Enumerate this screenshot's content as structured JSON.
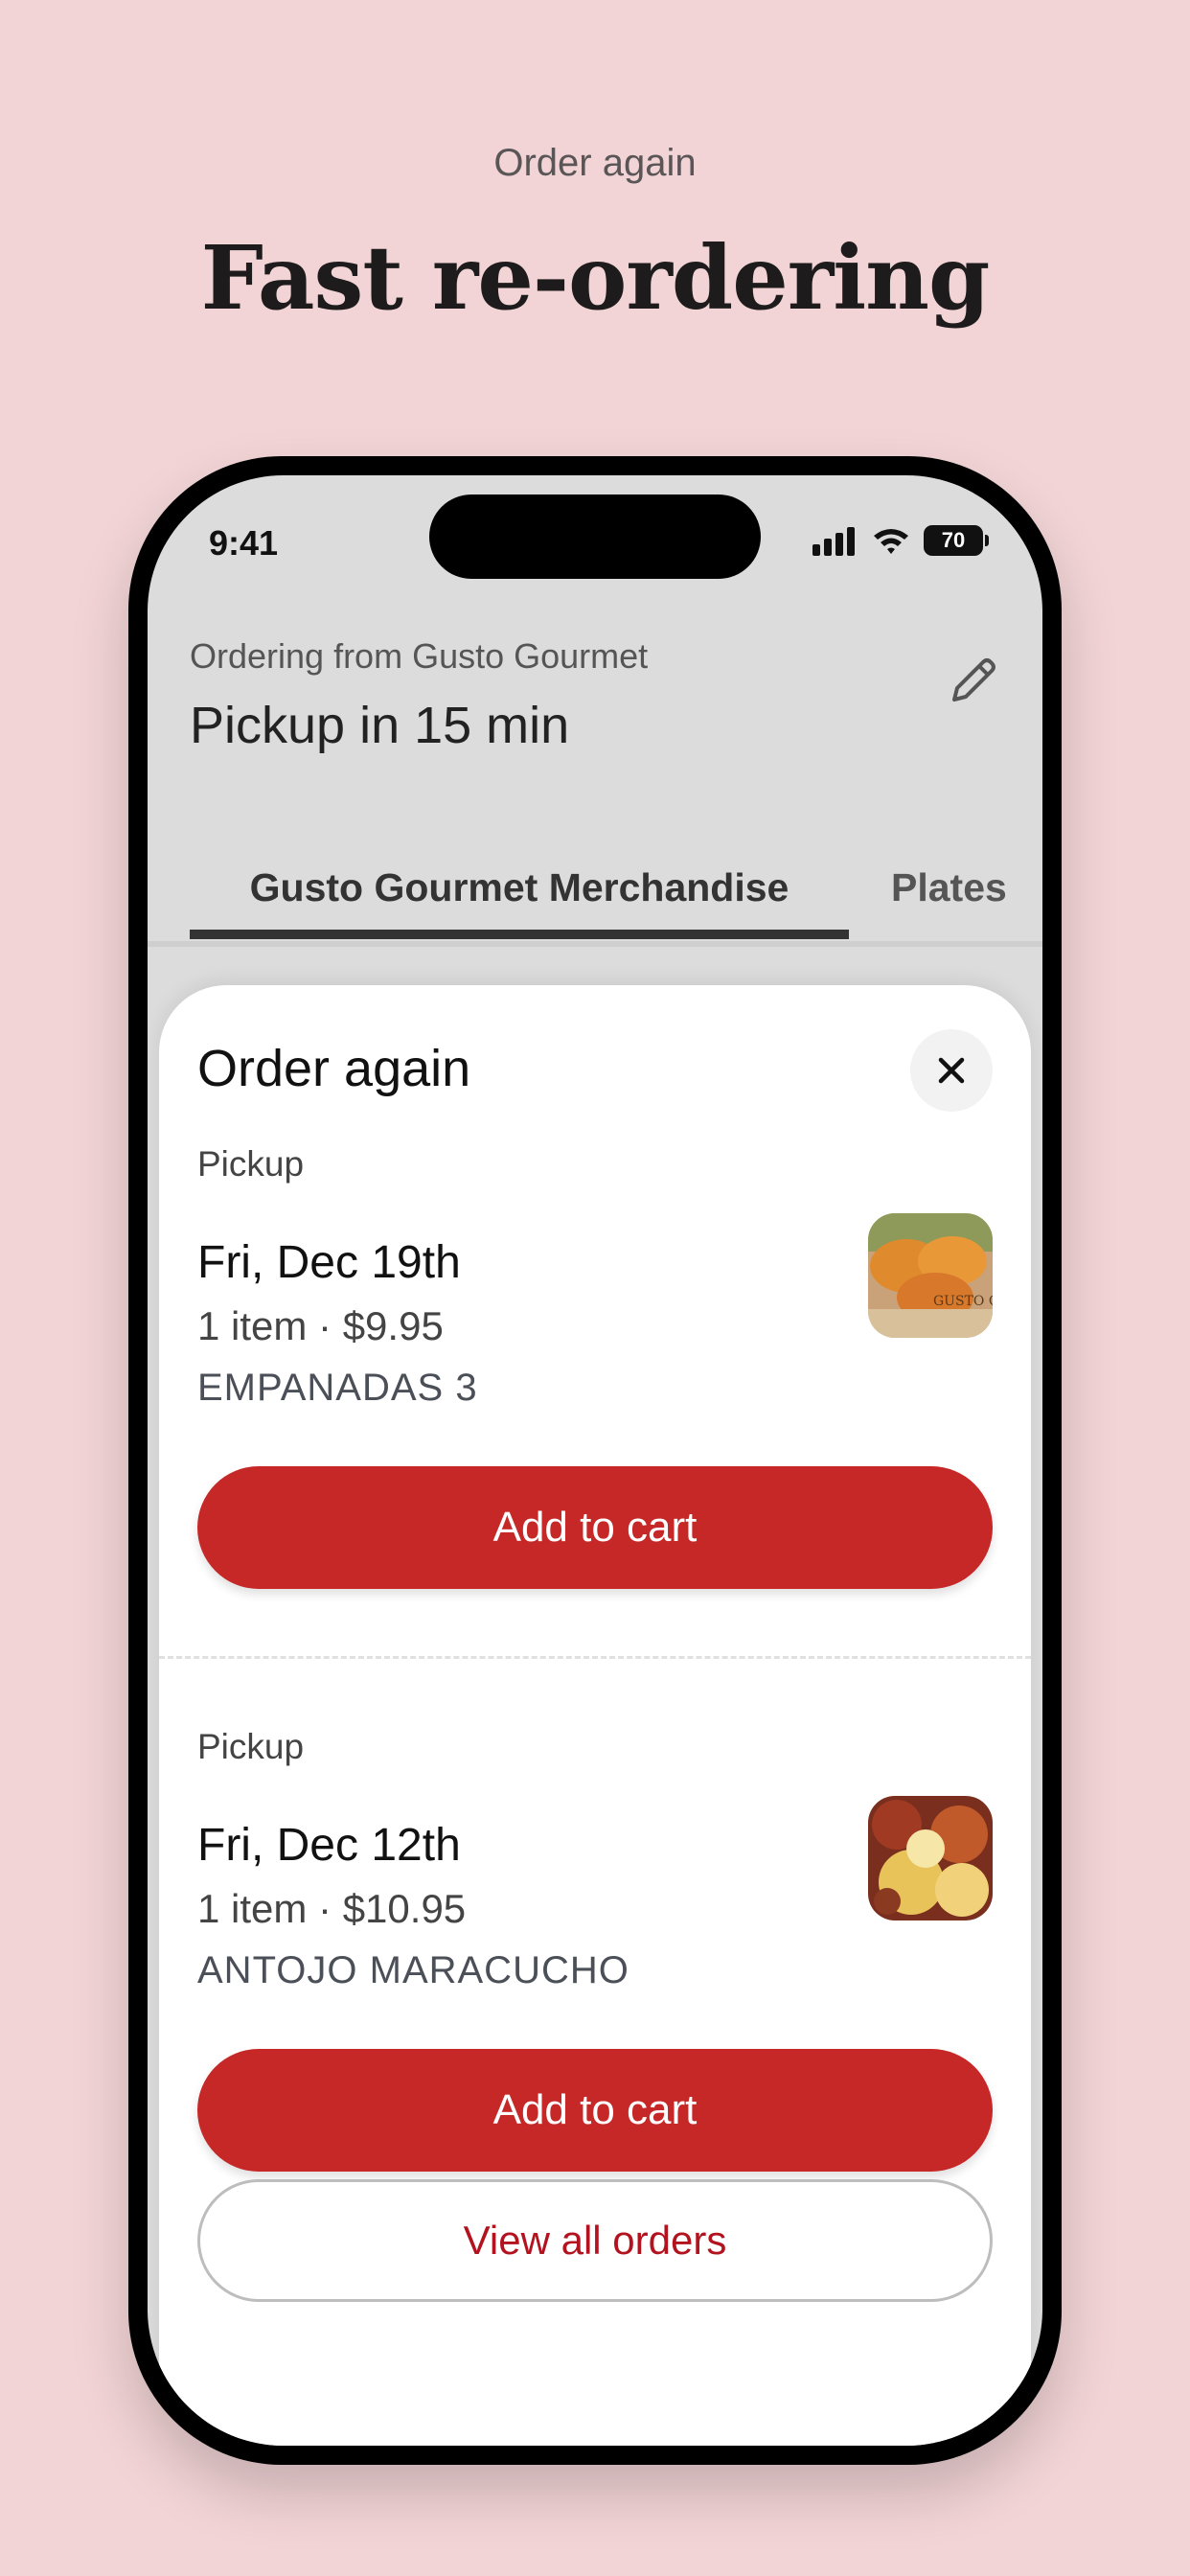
{
  "page": {
    "eyebrow": "Order again",
    "headline": "Fast re-ordering"
  },
  "status_bar": {
    "time": "9:41",
    "battery": "70",
    "icons": [
      "signal-icon",
      "wifi-icon",
      "battery-icon"
    ]
  },
  "header": {
    "ordering_from": "Ordering from Gusto Gourmet",
    "pickup_time": "Pickup in 15 min",
    "edit_icon": "pencil-icon"
  },
  "tabs": [
    {
      "label": "Gusto Gourmet Merchandise",
      "active": true
    },
    {
      "label": "Plates",
      "active": false
    }
  ],
  "sheet": {
    "title": "Order again",
    "close_icon": "close-icon",
    "orders": [
      {
        "kind": "Pickup",
        "date": "Fri, Dec 19th",
        "meta": "1 item · $9.95",
        "name": "EMPANADAS 3",
        "thumb": "empanadas-photo",
        "button": "Add to cart"
      },
      {
        "kind": "Pickup",
        "date": "Fri, Dec 12th",
        "meta": "1 item · $10.95",
        "name": "ANTOJO MARACUCHO",
        "thumb": "antojo-photo",
        "button": "Add to cart"
      }
    ],
    "view_all": "View all orders"
  },
  "colors": {
    "background": "#f2d4d6",
    "primary_button": "#c62828",
    "link_text": "#b3121f"
  }
}
